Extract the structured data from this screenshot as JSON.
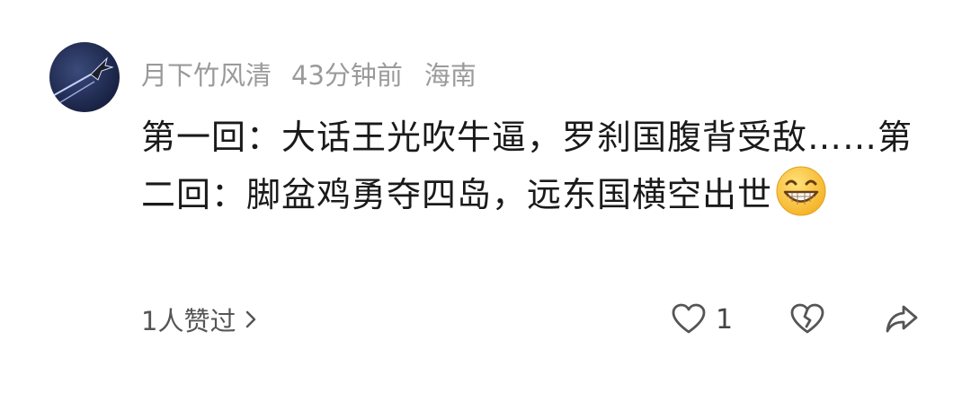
{
  "comment": {
    "author": "月下竹风清",
    "time": "43分钟前",
    "location": "海南",
    "text": "第一回：大话王光吹牛逼，罗刹国腹背受敌……第二回：脚盆鸡勇夺四岛，远东国横空出世",
    "emoji": "grinning-face-emoji",
    "liked_by": "1人赞过",
    "like_count": "1"
  },
  "icons": {
    "like": "heart-outline-icon",
    "dislike": "broken-heart-icon",
    "share": "share-arrow-icon",
    "more": "chevron-right-icon"
  },
  "colors": {
    "meta_text": "#9a9a9a",
    "body_text": "#1a1a1a",
    "icon_stroke": "#555555",
    "avatar_bg": "#1e2a5a"
  }
}
